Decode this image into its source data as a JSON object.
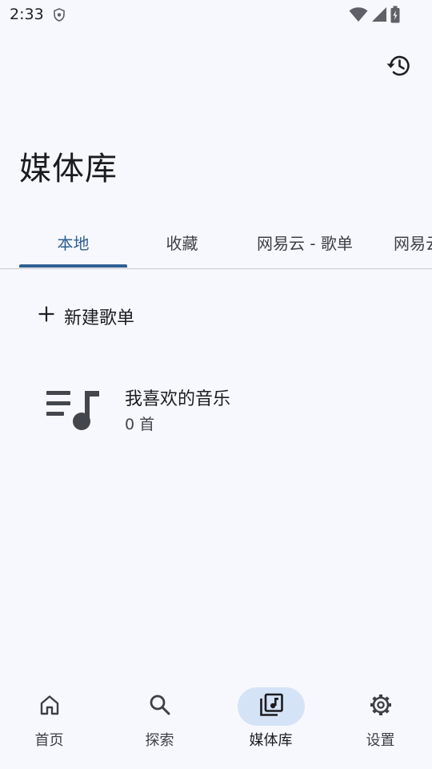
{
  "status_bar": {
    "time": "2:33",
    "icons": [
      "vpn-shield-icon",
      "wifi-icon",
      "cell-signal-icon",
      "battery-charging-icon"
    ]
  },
  "header": {
    "history_icon": "history-icon",
    "title": "媒体库"
  },
  "tabs": [
    {
      "label": "本地",
      "active": true
    },
    {
      "label": "收藏",
      "active": false
    },
    {
      "label": "网易云 - 歌单",
      "active": false
    },
    {
      "label": "网易云",
      "active": false
    }
  ],
  "actions": {
    "new_playlist_label": "新建歌单",
    "new_playlist_icon": "plus-icon"
  },
  "playlists": [
    {
      "name": "我喜欢的音乐",
      "count": "0 首",
      "icon": "playlist-music-icon"
    }
  ],
  "bottom_nav": [
    {
      "label": "首页",
      "icon": "home-icon",
      "active": false
    },
    {
      "label": "探索",
      "icon": "search-icon",
      "active": false
    },
    {
      "label": "媒体库",
      "icon": "library-music-icon",
      "active": true
    },
    {
      "label": "设置",
      "icon": "gear-icon",
      "active": false
    }
  ],
  "colors": {
    "background": "#f7f8fd",
    "accent": "#2e5f92",
    "nav_active_pill": "#d5e3f7"
  }
}
